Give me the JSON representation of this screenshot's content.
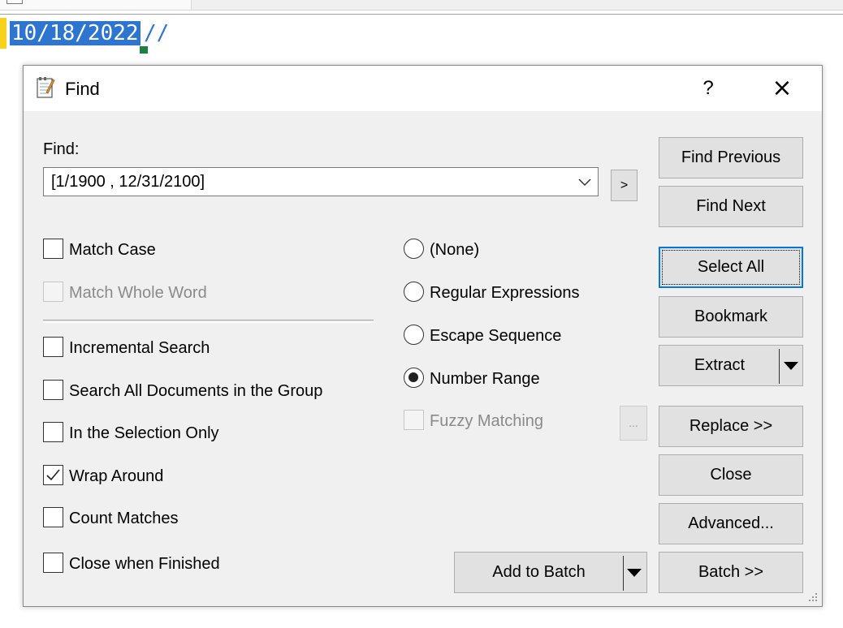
{
  "editor": {
    "selected_text": "10/18/2022",
    "trailing_marks": "//"
  },
  "dialog": {
    "title": "Find",
    "help_label": "?",
    "close_label": "×",
    "find_label": "Find:",
    "find_value": "[1/1900 , 12/31/2100]",
    "history_button_label": ">",
    "checkboxes": [
      {
        "label": "Match Case",
        "checked": false,
        "enabled": true
      },
      {
        "label": "Match Whole Word",
        "checked": false,
        "enabled": false
      },
      {
        "label": "Incremental Search",
        "checked": false,
        "enabled": true
      },
      {
        "label": "Search All Documents in the Group",
        "checked": false,
        "enabled": true
      },
      {
        "label": "In the Selection Only",
        "checked": false,
        "enabled": true
      },
      {
        "label": "Wrap Around",
        "checked": true,
        "enabled": true
      },
      {
        "label": "Count Matches",
        "checked": false,
        "enabled": true
      },
      {
        "label": "Close when Finished",
        "checked": false,
        "enabled": true
      }
    ],
    "radios": [
      {
        "label": "(None)",
        "selected": false
      },
      {
        "label": "Regular Expressions",
        "selected": false
      },
      {
        "label": "Escape Sequence",
        "selected": false
      },
      {
        "label": "Number Range",
        "selected": true
      }
    ],
    "fuzzy": {
      "label": "Fuzzy Matching",
      "enabled": false,
      "options_label": "..."
    },
    "buttons": {
      "find_previous": "Find Previous",
      "find_next": "Find Next",
      "select_all": "Select All",
      "bookmark": "Bookmark",
      "extract": "Extract",
      "replace": "Replace >>",
      "close": "Close",
      "advanced": "Advanced...",
      "batch": "Batch >>",
      "add_to_batch": "Add to Batch"
    }
  }
}
